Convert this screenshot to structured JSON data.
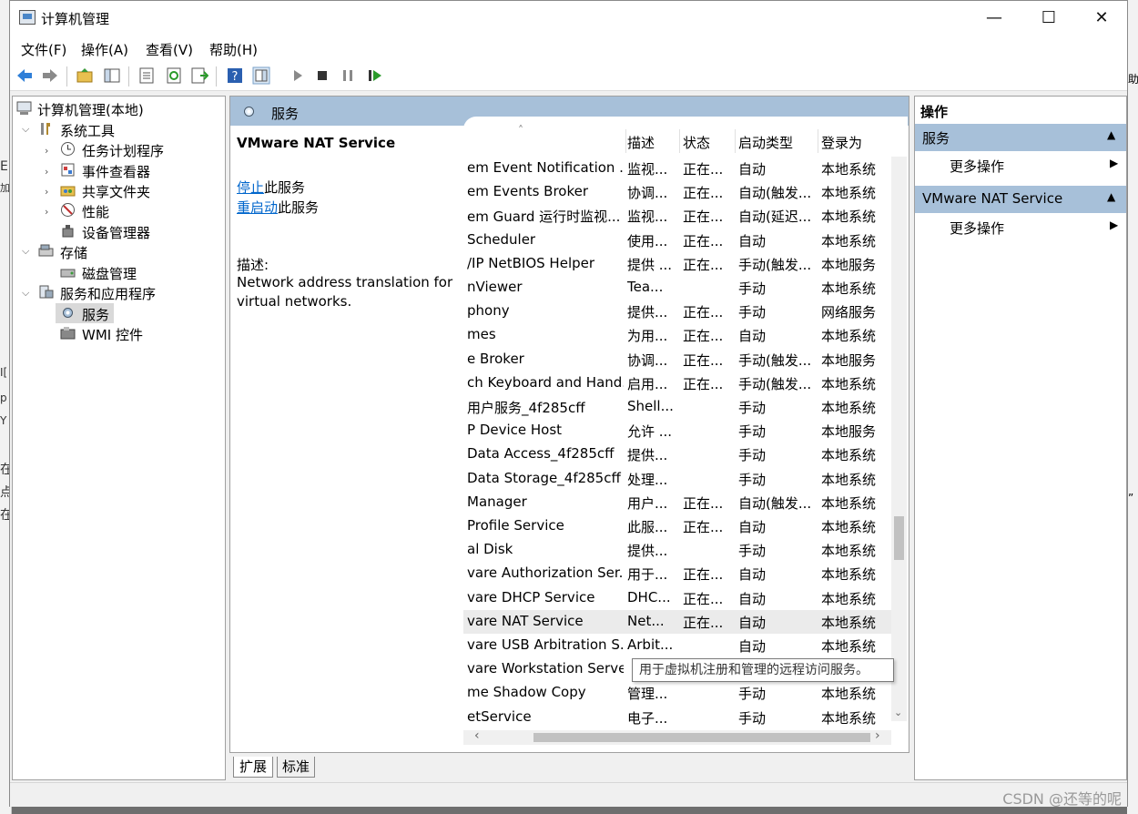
{
  "window": {
    "title": "计算机管理",
    "controls": {
      "minimize": "—",
      "maximize": "☐",
      "close": "✕"
    }
  },
  "menu": {
    "file": "文件(F)",
    "action": "操作(A)",
    "view": "查看(V)",
    "help": "帮助(H)"
  },
  "tree": {
    "root": "计算机管理(本地)",
    "system_tools": "系统工具",
    "task_scheduler": "任务计划程序",
    "event_viewer": "事件查看器",
    "shared_folders": "共享文件夹",
    "performance": "性能",
    "device_manager": "设备管理器",
    "storage": "存储",
    "disk_management": "磁盘管理",
    "services_apps": "服务和应用程序",
    "services": "服务",
    "wmi": "WMI 控件"
  },
  "services_panel": {
    "header": "服务",
    "selected_name": "VMware NAT Service",
    "stop_link": "停止",
    "stop_suffix": "此服务",
    "restart_link": "重启动",
    "restart_suffix": "此服务",
    "desc_label": "描述:",
    "desc_line1": "Network address translation for",
    "desc_line2": "virtual networks.",
    "sort_indicator": "˄",
    "columns": {
      "desc": "描述",
      "status": "状态",
      "startup": "启动类型",
      "logon": "登录为"
    },
    "tooltip": "用于虚拟机注册和管理的远程访问服务。",
    "tab_extended": "扩展",
    "tab_standard": "标准"
  },
  "rows": [
    {
      "name": "em Event Notification ...",
      "desc": "监视...",
      "status": "正在...",
      "startup": "自动",
      "logon": "本地系统"
    },
    {
      "name": "em Events Broker",
      "desc": "协调...",
      "status": "正在...",
      "startup": "自动(触发...",
      "logon": "本地系统"
    },
    {
      "name": "em Guard 运行时监视...",
      "desc": "监视...",
      "status": "正在...",
      "startup": "自动(延迟...",
      "logon": "本地系统"
    },
    {
      "name": "Scheduler",
      "desc": "使用...",
      "status": "正在...",
      "startup": "自动",
      "logon": "本地系统"
    },
    {
      "name": "/IP NetBIOS Helper",
      "desc": "提供 ...",
      "status": "正在...",
      "startup": "手动(触发...",
      "logon": "本地服务"
    },
    {
      "name": "nViewer",
      "desc": "Tea...",
      "status": "",
      "startup": "手动",
      "logon": "本地系统"
    },
    {
      "name": "phony",
      "desc": "提供...",
      "status": "正在...",
      "startup": "手动",
      "logon": "网络服务"
    },
    {
      "name": "mes",
      "desc": "为用...",
      "status": "正在...",
      "startup": "自动",
      "logon": "本地系统"
    },
    {
      "name": "e Broker",
      "desc": "协调...",
      "status": "正在...",
      "startup": "手动(触发...",
      "logon": "本地服务"
    },
    {
      "name": "ch Keyboard and Hand...",
      "desc": "启用...",
      "status": "正在...",
      "startup": "手动(触发...",
      "logon": "本地系统"
    },
    {
      "name": "用户服务_4f285cff",
      "desc": "Shell...",
      "status": "",
      "startup": "手动",
      "logon": "本地系统"
    },
    {
      "name": "P Device Host",
      "desc": "允许 ...",
      "status": "",
      "startup": "手动",
      "logon": "本地服务"
    },
    {
      "name": "Data Access_4f285cff",
      "desc": "提供...",
      "status": "",
      "startup": "手动",
      "logon": "本地系统"
    },
    {
      "name": "Data Storage_4f285cff",
      "desc": "处理...",
      "status": "",
      "startup": "手动",
      "logon": "本地系统"
    },
    {
      "name": "Manager",
      "desc": "用户...",
      "status": "正在...",
      "startup": "自动(触发...",
      "logon": "本地系统"
    },
    {
      "name": "Profile Service",
      "desc": "此服...",
      "status": "正在...",
      "startup": "自动",
      "logon": "本地系统"
    },
    {
      "name": "al Disk",
      "desc": "提供...",
      "status": "",
      "startup": "手动",
      "logon": "本地系统"
    },
    {
      "name": "vare Authorization Ser...",
      "desc": "用于...",
      "status": "正在...",
      "startup": "自动",
      "logon": "本地系统"
    },
    {
      "name": "vare DHCP Service",
      "desc": "DHC...",
      "status": "正在...",
      "startup": "自动",
      "logon": "本地系统"
    },
    {
      "name": "vare NAT Service",
      "desc": "Net...",
      "status": "正在...",
      "startup": "自动",
      "logon": "本地系统"
    },
    {
      "name": "vare USB Arbitration S...",
      "desc": "Arbit...",
      "status": "",
      "startup": "自动",
      "logon": "本地系统"
    },
    {
      "name": "vare Workstation Server",
      "desc": "",
      "status": "",
      "startup": "",
      "logon": ""
    },
    {
      "name": "me Shadow Copy",
      "desc": "管理...",
      "status": "",
      "startup": "手动",
      "logon": "本地系统"
    },
    {
      "name": "etService",
      "desc": "电子...",
      "status": "",
      "startup": "手动",
      "logon": "本地系统"
    }
  ],
  "actions": {
    "title": "操作",
    "section1": "服务",
    "more1": "更多操作",
    "section2": "VMware NAT Service",
    "more2": "更多操作"
  },
  "watermark": "CSDN @还等的呢",
  "background_letters": [
    "E",
    "加",
    "I[",
    "p",
    "Y",
    "在",
    "点",
    "在"
  ],
  "background_right": [
    "助",
    "”"
  ]
}
